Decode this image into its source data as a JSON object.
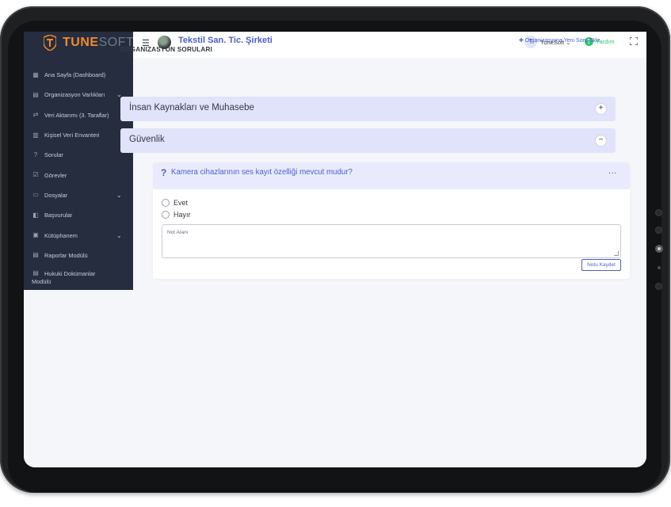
{
  "brand": {
    "part1": "TUNE",
    "part2": "SOFT",
    "accent": "#f28a2e"
  },
  "sidebar": {
    "items": [
      {
        "icon": "dashboard-icon",
        "label": "Ana Sayfa (Dashboard)",
        "chevron": false
      },
      {
        "icon": "assets-icon",
        "label": "Organizasyon Varlıkları",
        "chevron": true
      },
      {
        "icon": "transfer-icon",
        "label": "Veri Aktarımı (3. Taraflar)",
        "chevron": false
      },
      {
        "icon": "inventory-icon",
        "label": "Kişisel Veri Envanteri",
        "chevron": false
      },
      {
        "icon": "question-icon",
        "label": "Sorular",
        "chevron": false
      },
      {
        "icon": "tasks-icon",
        "label": "Görevler",
        "chevron": false
      },
      {
        "icon": "folder-icon",
        "label": "Dosyalar",
        "chevron": true
      },
      {
        "icon": "applications-icon",
        "label": "Başvurular",
        "chevron": false
      },
      {
        "icon": "library-icon",
        "label": "Kütüphanem",
        "chevron": true
      },
      {
        "icon": "report-icon",
        "label": "Raporlar Modülü",
        "chevron": false
      },
      {
        "icon": "legal-doc-icon",
        "label": "Hukuki Dokümanlar",
        "label2": "Modülü",
        "chevron": false
      }
    ]
  },
  "header": {
    "company": "Tekstil San. Tic. Şirketi",
    "user_initial": "T",
    "user_name": "TuneSoft",
    "help_label": "Yardım"
  },
  "main": {
    "title": "ORGANIZASYON SORULARI",
    "add_label": "Organizasyona Yeni Soru Ekle",
    "accordions": [
      {
        "title": "İnsan Kaynakları ve Muhasebe",
        "toggle": "+"
      },
      {
        "title": "Güvenlik",
        "toggle": "−"
      }
    ],
    "question": {
      "mark": "?",
      "text": "Kamera cihazlarının ses kayıt özelliği mevcut mudur?",
      "menu": "...",
      "options": [
        "Evet",
        "Hayır"
      ],
      "note_placeholder": "Not Alanı",
      "save_label": "Notu Kaydet"
    }
  },
  "colors": {
    "primary": "#4b5ec8",
    "success": "#28c76f",
    "sidebar_bg": "#262d3e"
  }
}
